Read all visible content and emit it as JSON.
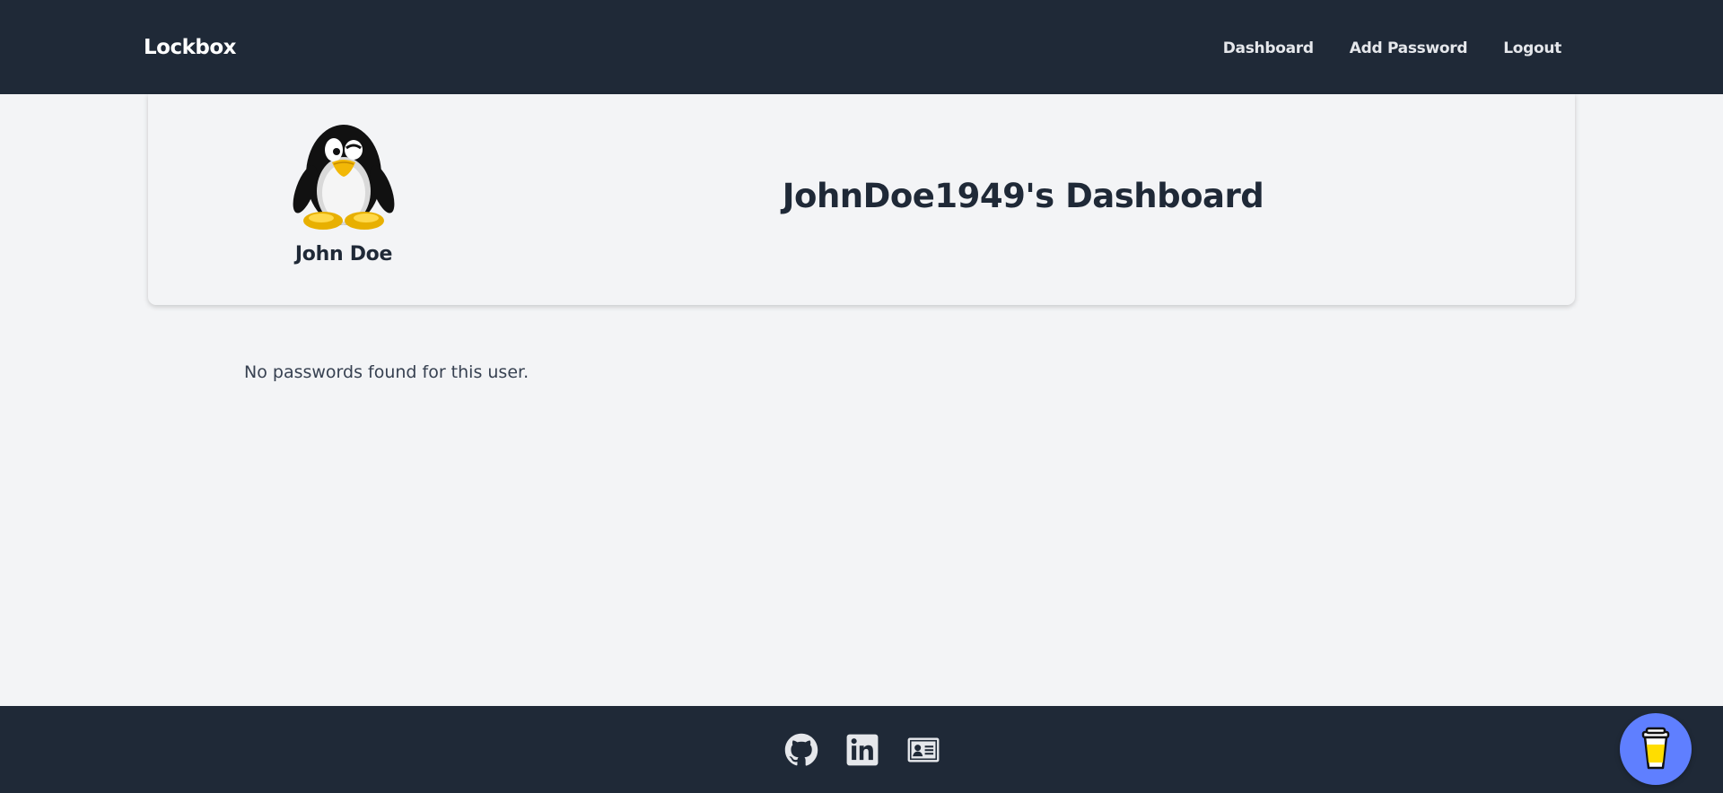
{
  "app": {
    "brand": "Lockbox"
  },
  "nav": {
    "items": [
      {
        "label": "Dashboard"
      },
      {
        "label": "Add Password"
      },
      {
        "label": "Logout"
      }
    ]
  },
  "profile": {
    "name": "John Doe",
    "dashboard_title": "JohnDoe1949's Dashboard",
    "avatar_icon": "penguin-avatar-icon"
  },
  "main": {
    "empty_message": "No passwords found for this user."
  },
  "footer": {
    "icons": [
      "github-icon",
      "linkedin-icon",
      "contact-card-icon"
    ]
  },
  "floating": {
    "icon": "coffee-cup-icon",
    "color": "#5f7fff"
  },
  "colors": {
    "navbar_bg": "#1f2937",
    "page_bg": "#f3f4f6",
    "text_dark": "#1f2937"
  }
}
